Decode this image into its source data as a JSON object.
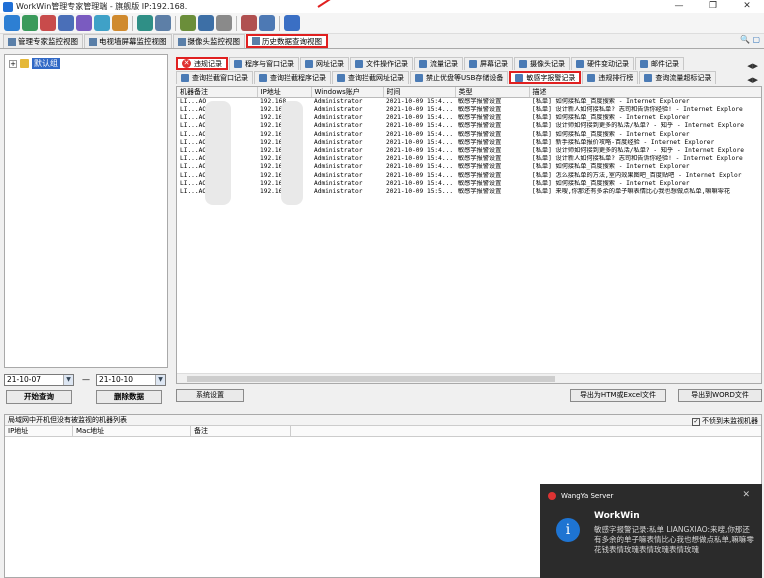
{
  "window": {
    "title": "WorkWin管理专家管理端 - 旗舰版 IP:192.168.",
    "controls": [
      "—",
      "❐",
      "✕"
    ]
  },
  "view_tabs": [
    {
      "label": "管理专家监控视图"
    },
    {
      "label": "电视墙屏幕监控视图"
    },
    {
      "label": "摄像头监控视图"
    },
    {
      "label": "历史数据查询视图"
    }
  ],
  "tree": {
    "root_label": "默认组"
  },
  "record_tabs_row1": [
    "违规记录",
    "程序与窗口记录",
    "网址记录",
    "文件操作记录",
    "流量记录",
    "屏幕记录",
    "摄像头记录",
    "硬件变动记录",
    "邮件记录"
  ],
  "record_tabs_row2": [
    "查询拦截窗口记录",
    "查询拦截程序记录",
    "查询拦截网址记录",
    "禁止优盘等USB存储设备",
    "敏感字报警记录",
    "违规排行榜",
    "查询流量超标记录"
  ],
  "grid": {
    "columns": [
      "机器备注",
      "IP地址",
      "Windows账户",
      "时间",
      "类型",
      "描述"
    ],
    "rows": [
      [
        "LI...AO",
        "192.168.",
        "Administrator",
        "2021-10-09 15:4...",
        "敏感字报警设置",
        "[私单] 如何接私单_百度搜索 - Internet Explorer"
      ],
      [
        "LI...AO",
        "192.168.",
        "Administrator",
        "2021-10-09 15:4...",
        "敏感字报警设置",
        "[私单] 设计新人如何接私单? 志司和告诉你经验! - Internet Explore"
      ],
      [
        "LI...AO",
        "192.168.",
        "Administrator",
        "2021-10-09 15:4...",
        "敏感字报警设置",
        "[私单] 如何接私单_百度搜索 - Internet Explorer"
      ],
      [
        "LI...AO",
        "192.168.",
        "Administrator",
        "2021-10-09 15:4...",
        "敏感字报警设置",
        "[私单] 设计师如何接到更多的私活/私单? - 知乎 - Internet Explore"
      ],
      [
        "LI...AO",
        "192.168.",
        "Administrator",
        "2021-10-09 15:4...",
        "敏感字报警设置",
        "[私单] 如何接私单_百度搜索 - Internet Explorer"
      ],
      [
        "LI...AO",
        "192.168.",
        "Administrator",
        "2021-10-09 15:4...",
        "敏感字报警设置",
        "[私单] 新手接私单报价攻略-百度经验 - Internet Explorer"
      ],
      [
        "LI...AO",
        "192.168.",
        "Administrator",
        "2021-10-09 15:4...",
        "敏感字报警设置",
        "[私单] 设计师如何接到更多的私活/私单? - 知乎 - Internet Explore"
      ],
      [
        "LI...AO",
        "192.168.",
        "Administrator",
        "2021-10-09 15:4...",
        "敏感字报警设置",
        "[私单] 设计新人如何接私单? 志司和告诉你经验! - Internet Explore"
      ],
      [
        "LI...AO",
        "192.168.",
        "Administrator",
        "2021-10-09 15:4...",
        "敏感字报警设置",
        "[私单] 如何接私单_百度搜索 - Internet Explorer"
      ],
      [
        "LI...AO",
        "192.168.",
        "Administrator",
        "2021-10-09 15:4...",
        "敏感字报警设置",
        "[私单] 怎么接私单的方法,室内效果图吧_百度贴吧 - Internet Explor"
      ],
      [
        "LI...AO",
        "192.168.",
        "Administrator",
        "2021-10-09 15:4...",
        "敏感字报警设置",
        "[私单] 如何接私单_百度搜索 - Internet Explorer"
      ],
      [
        "LI...AO",
        "192.168.",
        "Administrator",
        "2021-10-09 15:5...",
        "敏感字报警设置",
        "[私单] 来嗖,你那还有多余的单子嘛表情比心我也想做点私单,嘛嘛零花"
      ]
    ]
  },
  "left_controls": {
    "date_from": "21-10-07",
    "date_sep": "—",
    "date_to": "21-10-10",
    "query_button": "开始查询",
    "delete_button": "删除数据"
  },
  "bottom_buttons": {
    "settings": "系统设置",
    "export_excel": "导出为HTM或Excel文件",
    "export_word": "导出到WORD文件"
  },
  "bottom_panel": {
    "title": "局域网中开机但没有被监视的机器列表",
    "checkbox_label": "不侦到未监视机器",
    "checkbox_mark": "✓",
    "columns": [
      "IP地址",
      "Mac地址",
      "备注"
    ]
  },
  "toast": {
    "app": "WangYa Server",
    "close": "✕",
    "icon": "i",
    "title": "WorkWin",
    "body": "敏感字报警记录:私单 LIANGXIAO:来嗖,你那还有多余的单子嘛表情比心我也想做点私单,嘛嘛零花钱表情玫瑰表情玫瑰表情玫瑰"
  },
  "colors": {
    "highlight": "#e02020",
    "selection": "#3169c6",
    "toast_bg": "#2b2b2b",
    "info_blue": "#1e74d2"
  }
}
